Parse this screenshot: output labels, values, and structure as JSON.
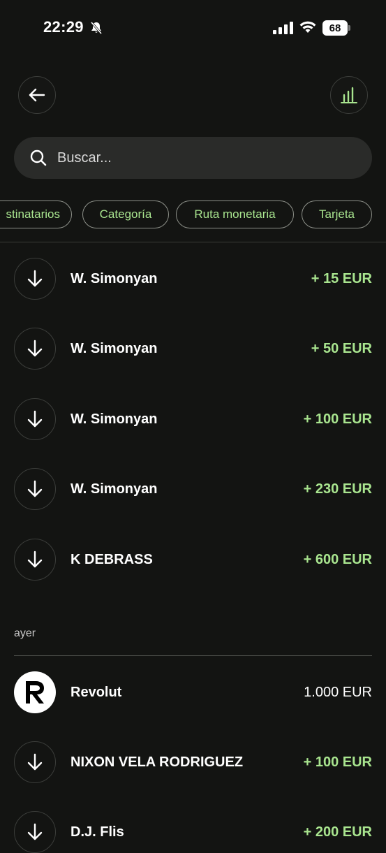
{
  "status_bar": {
    "time": "22:29",
    "battery": "68"
  },
  "search": {
    "placeholder": "Buscar..."
  },
  "filters": [
    "stinatarios",
    "Categoría",
    "Ruta monetaria",
    "Tarjeta"
  ],
  "transactions_today": [
    {
      "name": "W. Simonyan",
      "amount": "+ 15 EUR",
      "icon": "arrow-down-icon"
    },
    {
      "name": "W. Simonyan",
      "amount": "+ 50 EUR",
      "icon": "arrow-down-icon"
    },
    {
      "name": "W. Simonyan",
      "amount": "+ 100 EUR",
      "icon": "arrow-down-icon"
    },
    {
      "name": "W. Simonyan",
      "amount": "+ 230 EUR",
      "icon": "arrow-down-icon"
    },
    {
      "name": "K DEBRASS",
      "amount": "+ 600 EUR",
      "icon": "arrow-down-icon"
    }
  ],
  "section_yesterday": {
    "label": "ayer"
  },
  "transactions_yesterday": [
    {
      "name": "Revolut",
      "amount": "1.000 EUR",
      "icon": "revolut-logo-icon"
    },
    {
      "name": "NIXON VELA RODRIGUEZ",
      "amount": "+ 100 EUR",
      "icon": "arrow-down-icon"
    },
    {
      "name": "D.J. Flis",
      "amount": "+ 200 EUR",
      "icon": "arrow-down-icon"
    }
  ],
  "colors": {
    "background": "#131412",
    "accent_green": "#a9e58f",
    "search_bg": "#2a2b29"
  }
}
